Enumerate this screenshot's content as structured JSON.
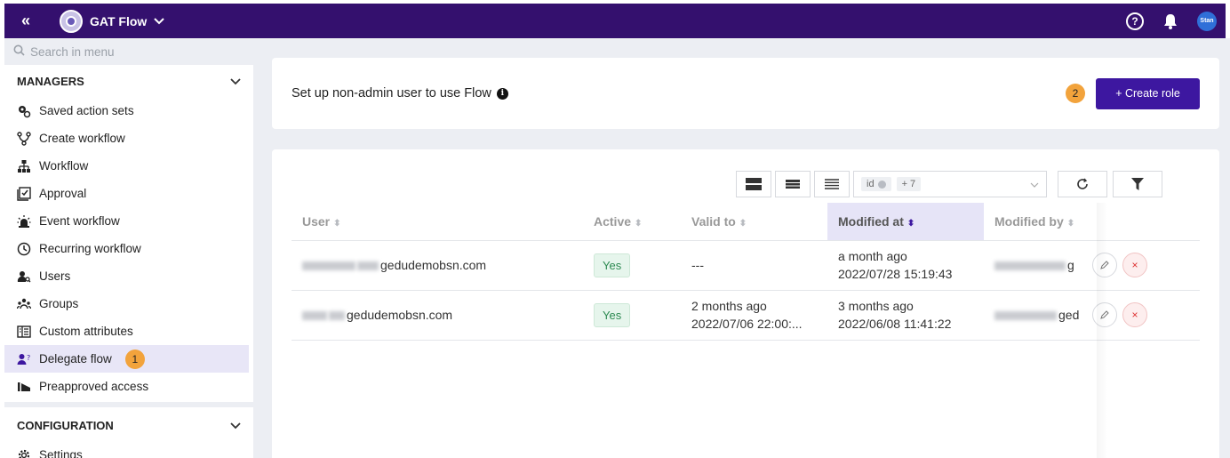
{
  "topbar": {
    "collapse_glyph": "«",
    "app_name": "GAT Flow",
    "help_glyph": "?",
    "avatar_text": "Stan",
    "brand_color": "#34106e"
  },
  "sidebar": {
    "search_placeholder": "Search in menu",
    "managers": {
      "label": "MANAGERS",
      "items": [
        {
          "label": "Saved action sets",
          "icon": "gears-icon"
        },
        {
          "label": "Create workflow",
          "icon": "branch-icon"
        },
        {
          "label": "Workflow",
          "icon": "hierarchy-icon"
        },
        {
          "label": "Approval",
          "icon": "approval-icon"
        },
        {
          "label": "Event workflow",
          "icon": "alarm-icon"
        },
        {
          "label": "Recurring workflow",
          "icon": "clock-icon"
        },
        {
          "label": "Users",
          "icon": "user-search-icon"
        },
        {
          "label": "Groups",
          "icon": "group-icon"
        },
        {
          "label": "Custom attributes",
          "icon": "attributes-icon"
        },
        {
          "label": "Delegate flow",
          "icon": "delegate-icon",
          "active": true,
          "step": "1"
        },
        {
          "label": "Preapproved access",
          "icon": "preapproved-icon"
        }
      ]
    },
    "configuration": {
      "label": "CONFIGURATION",
      "items": [
        {
          "label": "Settings",
          "icon": "gear-icon"
        }
      ]
    }
  },
  "header_card": {
    "title": "Set up non-admin user to use Flow",
    "info_glyph": "i",
    "step": "2",
    "create_button": "+ Create role",
    "accent": "#3d17a0"
  },
  "toolbar": {
    "column_chip": "id",
    "more_chip": "+ 7"
  },
  "table": {
    "headers": [
      "User",
      "Active",
      "Valid to",
      "Modified at",
      "Modified by"
    ],
    "sorted_column": "Modified at",
    "rows": [
      {
        "user": "gedudemobsn.com",
        "active": "Yes",
        "valid_to_1": "---",
        "valid_to_2": "",
        "modified_at_1": "a month ago",
        "modified_at_2": "2022/07/28 15:19:43",
        "modified_by": "g"
      },
      {
        "user": "gedudemobsn.com",
        "active": "Yes",
        "valid_to_1": "2 months ago",
        "valid_to_2": "2022/07/06 22:00:...",
        "modified_at_1": "3 months ago",
        "modified_at_2": "2022/06/08 11:41:22",
        "modified_by": "ged"
      }
    ]
  }
}
